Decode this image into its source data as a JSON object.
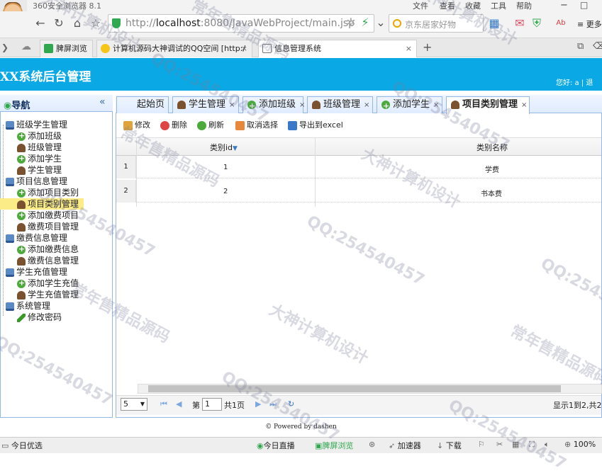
{
  "browser": {
    "title": "360安全浏览器 8.1",
    "menu": [
      "文件",
      "查看",
      "收藏",
      "工具",
      "帮助"
    ],
    "url_prefix": "http://",
    "url_host": "localhost",
    "url_rest": ":8080/JavaWebProject/main.jsp",
    "search_placeholder": "京东居家好物",
    "more_label": "更多",
    "tabs": [
      {
        "label": "脾屏浏览"
      },
      {
        "label": "计算机源码大神调试的QQ空间 [http:/"
      },
      {
        "label": "信息管理系统"
      }
    ],
    "new_tab": "+"
  },
  "app": {
    "title": "XX系统后台管理",
    "greeting": "您好: a | 退"
  },
  "nav": {
    "title": "导航",
    "collapse": "«",
    "tree": [
      {
        "label": "班级学生管理",
        "icon": "folder-icon",
        "level": 0
      },
      {
        "label": "添加班级",
        "icon": "add-icon",
        "level": 1
      },
      {
        "label": "班级管理",
        "icon": "user-icon",
        "level": 1
      },
      {
        "label": "添加学生",
        "icon": "add-icon",
        "level": 1
      },
      {
        "label": "学生管理",
        "icon": "user-icon",
        "level": 1
      },
      {
        "label": "项目信息管理",
        "icon": "folder-icon",
        "level": 0
      },
      {
        "label": "添加项目类别",
        "icon": "add-icon",
        "level": 1
      },
      {
        "label": "项目类别管理",
        "icon": "user-icon",
        "level": 1,
        "selected": true
      },
      {
        "label": "添加缴费项目",
        "icon": "add-icon",
        "level": 1
      },
      {
        "label": "缴费项目管理",
        "icon": "user-icon",
        "level": 1
      },
      {
        "label": "缴费信息管理",
        "icon": "folder-icon",
        "level": 0
      },
      {
        "label": "添加缴费信息",
        "icon": "add-icon",
        "level": 1
      },
      {
        "label": "缴费信息管理",
        "icon": "user-icon",
        "level": 1
      },
      {
        "label": "学生充值管理",
        "icon": "folder-icon",
        "level": 0
      },
      {
        "label": "添加学生充值",
        "icon": "add-icon",
        "level": 1
      },
      {
        "label": "学生充值管理",
        "icon": "user-icon",
        "level": 1
      },
      {
        "label": "系统管理",
        "icon": "folder-icon",
        "level": 0
      },
      {
        "label": "修改密码",
        "icon": "pencil-icon",
        "level": 1
      }
    ]
  },
  "tabs": [
    {
      "label": "起始页",
      "closable": false
    },
    {
      "label": "学生管理",
      "closable": true,
      "close": "×"
    },
    {
      "label": "添加班级",
      "closable": true,
      "close": "×"
    },
    {
      "label": "班级管理",
      "closable": true,
      "close": "×"
    },
    {
      "label": "添加学生",
      "closable": true,
      "close": "×"
    },
    {
      "label": "项目类别管理",
      "closable": true,
      "close": "×",
      "active": true
    }
  ],
  "toolbar": {
    "edit": "修改",
    "delete": "删除",
    "refresh": "刷新",
    "cancel_select": "取消选择",
    "export": "导出到excel"
  },
  "grid": {
    "columns": [
      "类别id",
      "类别名称"
    ],
    "sort_indicator": "▼",
    "rows": [
      {
        "num": "1",
        "id": "1",
        "name": "学费"
      },
      {
        "num": "2",
        "id": "2",
        "name": "书本费"
      }
    ]
  },
  "pager": {
    "page_size": "5",
    "page_label": "第",
    "page_value": "1",
    "total_pages": "共1页",
    "summary": "显示1到2,共2"
  },
  "footer": "© Powered by dashen",
  "statusbar": {
    "left": "今日优选",
    "live": "今日直播",
    "screen": "脾屏浏览",
    "accelerator": "加速器",
    "download": "下载",
    "zoom": "100%"
  },
  "watermark": {
    "a": "大神计算机设计",
    "b": "QQ:254540457",
    "c": "常年售精品源码"
  },
  "colors": {
    "header": "#0aa9e5",
    "panel_border": "#95b8e7",
    "selected": "#fbec88"
  }
}
